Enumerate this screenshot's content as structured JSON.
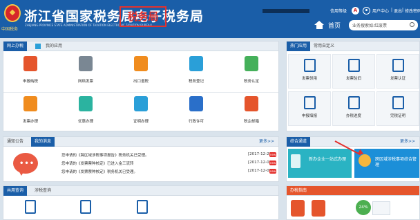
{
  "header": {
    "logo_caption": "中国税务",
    "title": "浙江省国家税务局电子税务局",
    "subtitle": "ZHEJIANG PROVINCE STATE ADMINISTRATION OF TAXATION ELECTRONIC TAXATION BUREAU",
    "watermark": "税务局",
    "user_level": "信用等级",
    "level_badge": "A",
    "user_center": "用户中心",
    "logout": "退出",
    "change_password": "修改密码",
    "home": "首页",
    "search_placeholder": "业务搜索如:红废票"
  },
  "online_tax": {
    "tab_active": "网上办税",
    "tab_other": "我的应用",
    "items": [
      {
        "label": "申报纳税",
        "color": "#e5552c"
      },
      {
        "label": "网络发票",
        "color": "#7a8793"
      },
      {
        "label": "出口退税",
        "color": "#f08c1e"
      },
      {
        "label": "税务登记",
        "color": "#2a9fd8"
      },
      {
        "label": "税务认定",
        "color": "#45b05a"
      },
      {
        "label": "发票办理",
        "color": "#f08c1e"
      },
      {
        "label": "优惠办理",
        "color": "#2bb3a0"
      },
      {
        "label": "证明办理",
        "color": "#2a9fd8"
      },
      {
        "label": "行政许可",
        "color": "#2a6fc9"
      },
      {
        "label": "税企邮箱",
        "color": "#e5552c"
      }
    ]
  },
  "hot_apps": {
    "tab_active": "热门应用",
    "tab_other": "常用自定义",
    "items": [
      {
        "label": "发票领用"
      },
      {
        "label": "发票验旧"
      },
      {
        "label": "发票认证"
      },
      {
        "label": "申报填报"
      },
      {
        "label": "办税进度"
      },
      {
        "label": "完税证明"
      }
    ]
  },
  "notices": {
    "tab_other": "通知公告",
    "tab_active": "我的消息",
    "more": "更多>>",
    "chat_dots": "•••",
    "items": [
      {
        "text": "您申请的《跨区域涉税事项报告》税务机关已受理。",
        "date": "[2017-12-22]",
        "badge": "new"
      },
      {
        "text": "您申请的《发票票种核定》已进入金三流转",
        "date": "[2017-12-05]",
        "badge": "new"
      },
      {
        "text": "您申请的《发票票种核定》税务机关已受理。",
        "date": "[2017-12-05]",
        "badge": "new"
      }
    ]
  },
  "channel": {
    "title": "综合通道",
    "more": "更多>>",
    "banner1": "新办企业一站式办理",
    "banner2": "跨区域涉税事项综合管理"
  },
  "bottom_left": {
    "tab_active": "共用查询",
    "tab_other": "涉税查询"
  },
  "bottom_right": {
    "title": "办税指南",
    "stat": "24%",
    "stat_color": "#4caf50"
  }
}
